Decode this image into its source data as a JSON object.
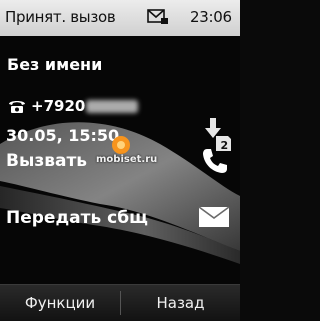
{
  "status_bar": {
    "title": "Принят. вызов",
    "time": "23:06",
    "message_icon": "envelope-with-badge-icon"
  },
  "contact": {
    "name": "Без имени",
    "phone_icon": "phone-icon",
    "phone_number_visible": "+7920",
    "datetime": "30.05, 15:50",
    "sim_icon": "sim2-download-icon"
  },
  "watermark": {
    "text": "mobiset.ru"
  },
  "actions": [
    {
      "label": "Вызвать",
      "icon": "handset-icon"
    },
    {
      "label": "Передать сбщ",
      "icon": "envelope-icon"
    }
  ],
  "softkeys": {
    "left": "Функции",
    "right": "Назад"
  },
  "colors": {
    "status_bar_bg": "#e0e0e0",
    "content_bg": "#060606",
    "text": "#ffffff",
    "watermark_accent": "#f7941d"
  }
}
